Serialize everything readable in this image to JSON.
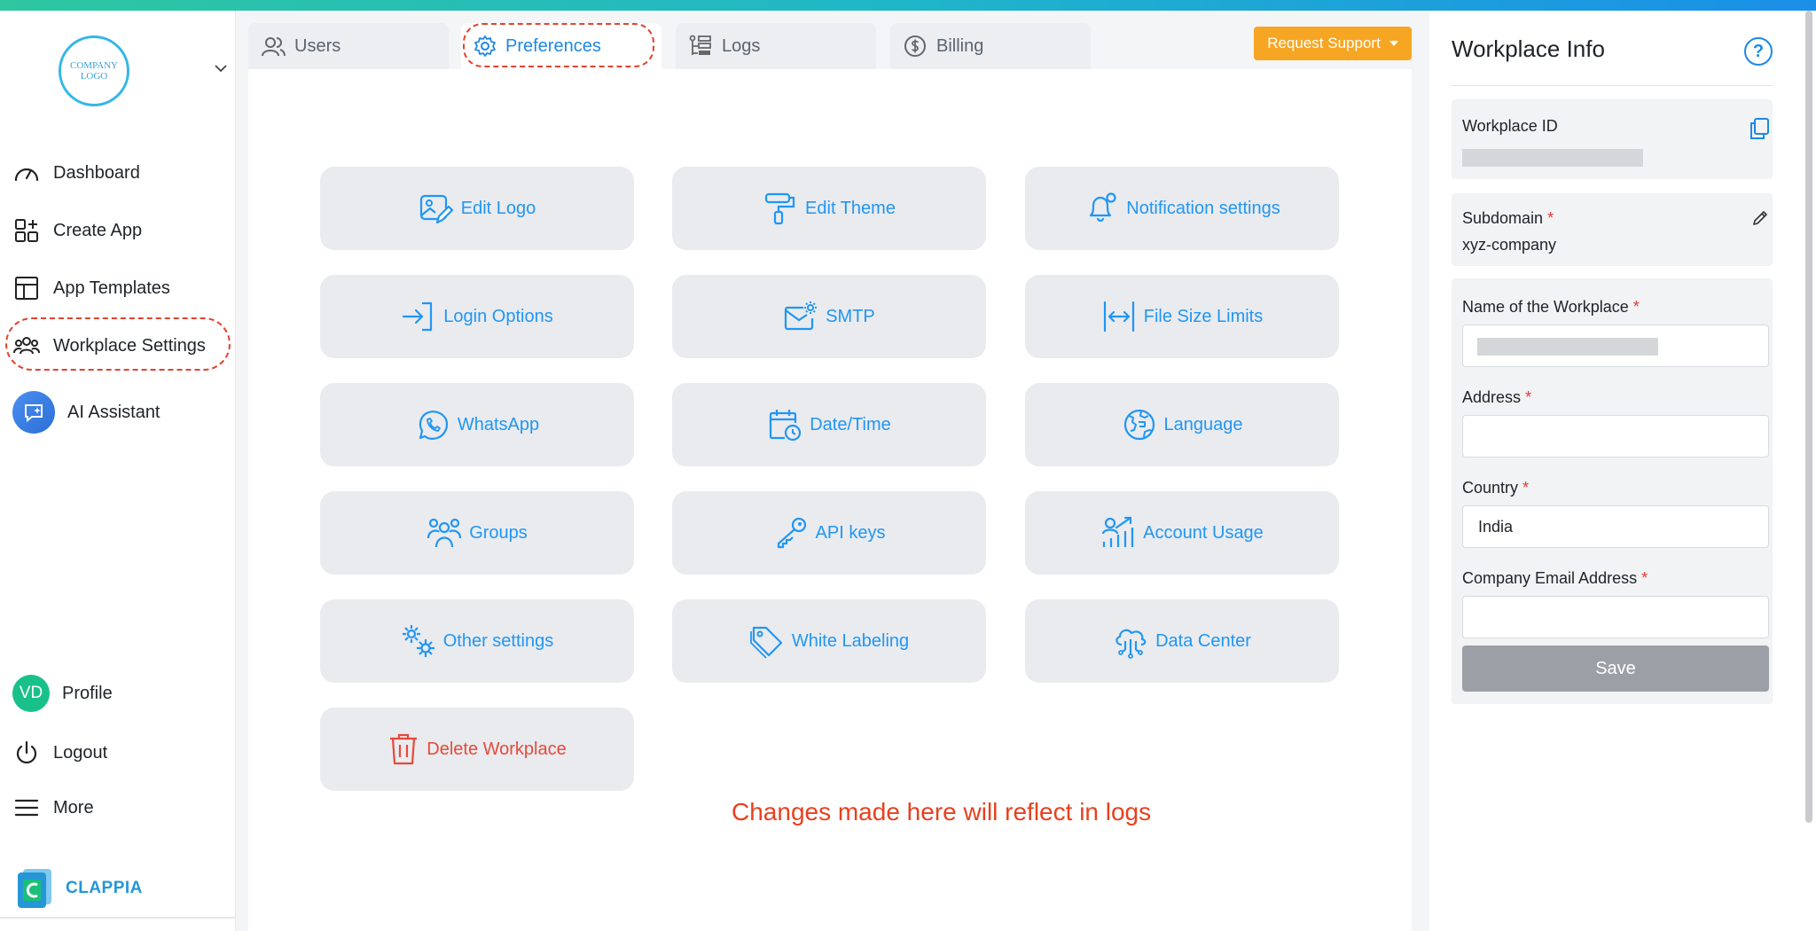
{
  "logo": {
    "text_line1": "COMPANY",
    "text_line2": "LOGO"
  },
  "sidebar": {
    "items": [
      {
        "label": "Dashboard",
        "icon": "gauge-icon"
      },
      {
        "label": "Create App",
        "icon": "grid-plus-icon"
      },
      {
        "label": "App Templates",
        "icon": "layout-icon"
      },
      {
        "label": "Workplace Settings",
        "icon": "users-icon"
      },
      {
        "label": "AI Assistant",
        "icon": "ai-chat-icon"
      }
    ],
    "bottom": [
      {
        "label": "Profile",
        "avatar": "VD"
      },
      {
        "label": "Logout",
        "icon": "power-icon"
      },
      {
        "label": "More",
        "icon": "menu-icon"
      }
    ],
    "brand": "CLAPPIA"
  },
  "tabs": [
    {
      "label": "Users",
      "icon": "users-icon"
    },
    {
      "label": "Preferences",
      "icon": "gear-icon",
      "active": true
    },
    {
      "label": "Logs",
      "icon": "logs-icon"
    },
    {
      "label": "Billing",
      "icon": "dollar-icon"
    }
  ],
  "request_support": "Request Support",
  "tiles": [
    {
      "label": "Edit Logo",
      "icon": "edit-image-icon"
    },
    {
      "label": "Edit Theme",
      "icon": "paint-roller-icon"
    },
    {
      "label": "Notification settings",
      "icon": "bell-icon"
    },
    {
      "label": "Login Options",
      "icon": "login-icon"
    },
    {
      "label": "SMTP",
      "icon": "mail-gear-icon"
    },
    {
      "label": "File Size Limits",
      "icon": "width-arrows-icon"
    },
    {
      "label": "WhatsApp",
      "icon": "whatsapp-icon"
    },
    {
      "label": "Date/Time",
      "icon": "calendar-clock-icon"
    },
    {
      "label": "Language",
      "icon": "globe-icon"
    },
    {
      "label": "Groups",
      "icon": "group-icon"
    },
    {
      "label": "API keys",
      "icon": "key-icon"
    },
    {
      "label": "Account Usage",
      "icon": "usage-chart-icon"
    },
    {
      "label": "Other settings",
      "icon": "gears-icon"
    },
    {
      "label": "White Labeling",
      "icon": "tag-icon"
    },
    {
      "label": "Data Center",
      "icon": "cloud-network-icon"
    },
    {
      "label": "Delete Workplace",
      "icon": "trash-icon"
    }
  ],
  "note": "Changes made here will reflect in logs",
  "workplace_info": {
    "title": "Workplace Info",
    "help": "?",
    "workplace_id_label": "Workplace ID",
    "subdomain_label": "Subdomain",
    "subdomain_value": "xyz-company",
    "name_label": "Name of the Workplace",
    "address_label": "Address",
    "address_value": "",
    "country_label": "Country",
    "country_value": "India",
    "email_label": "Company Email Address",
    "email_value": "",
    "required_mark": "*",
    "save_label": "Save"
  },
  "colors": {
    "accent": "#1e88e5",
    "danger": "#e8493a",
    "highlight": "#e0432f",
    "support_button": "#f6a623",
    "tile_bg": "#e9ebef"
  }
}
